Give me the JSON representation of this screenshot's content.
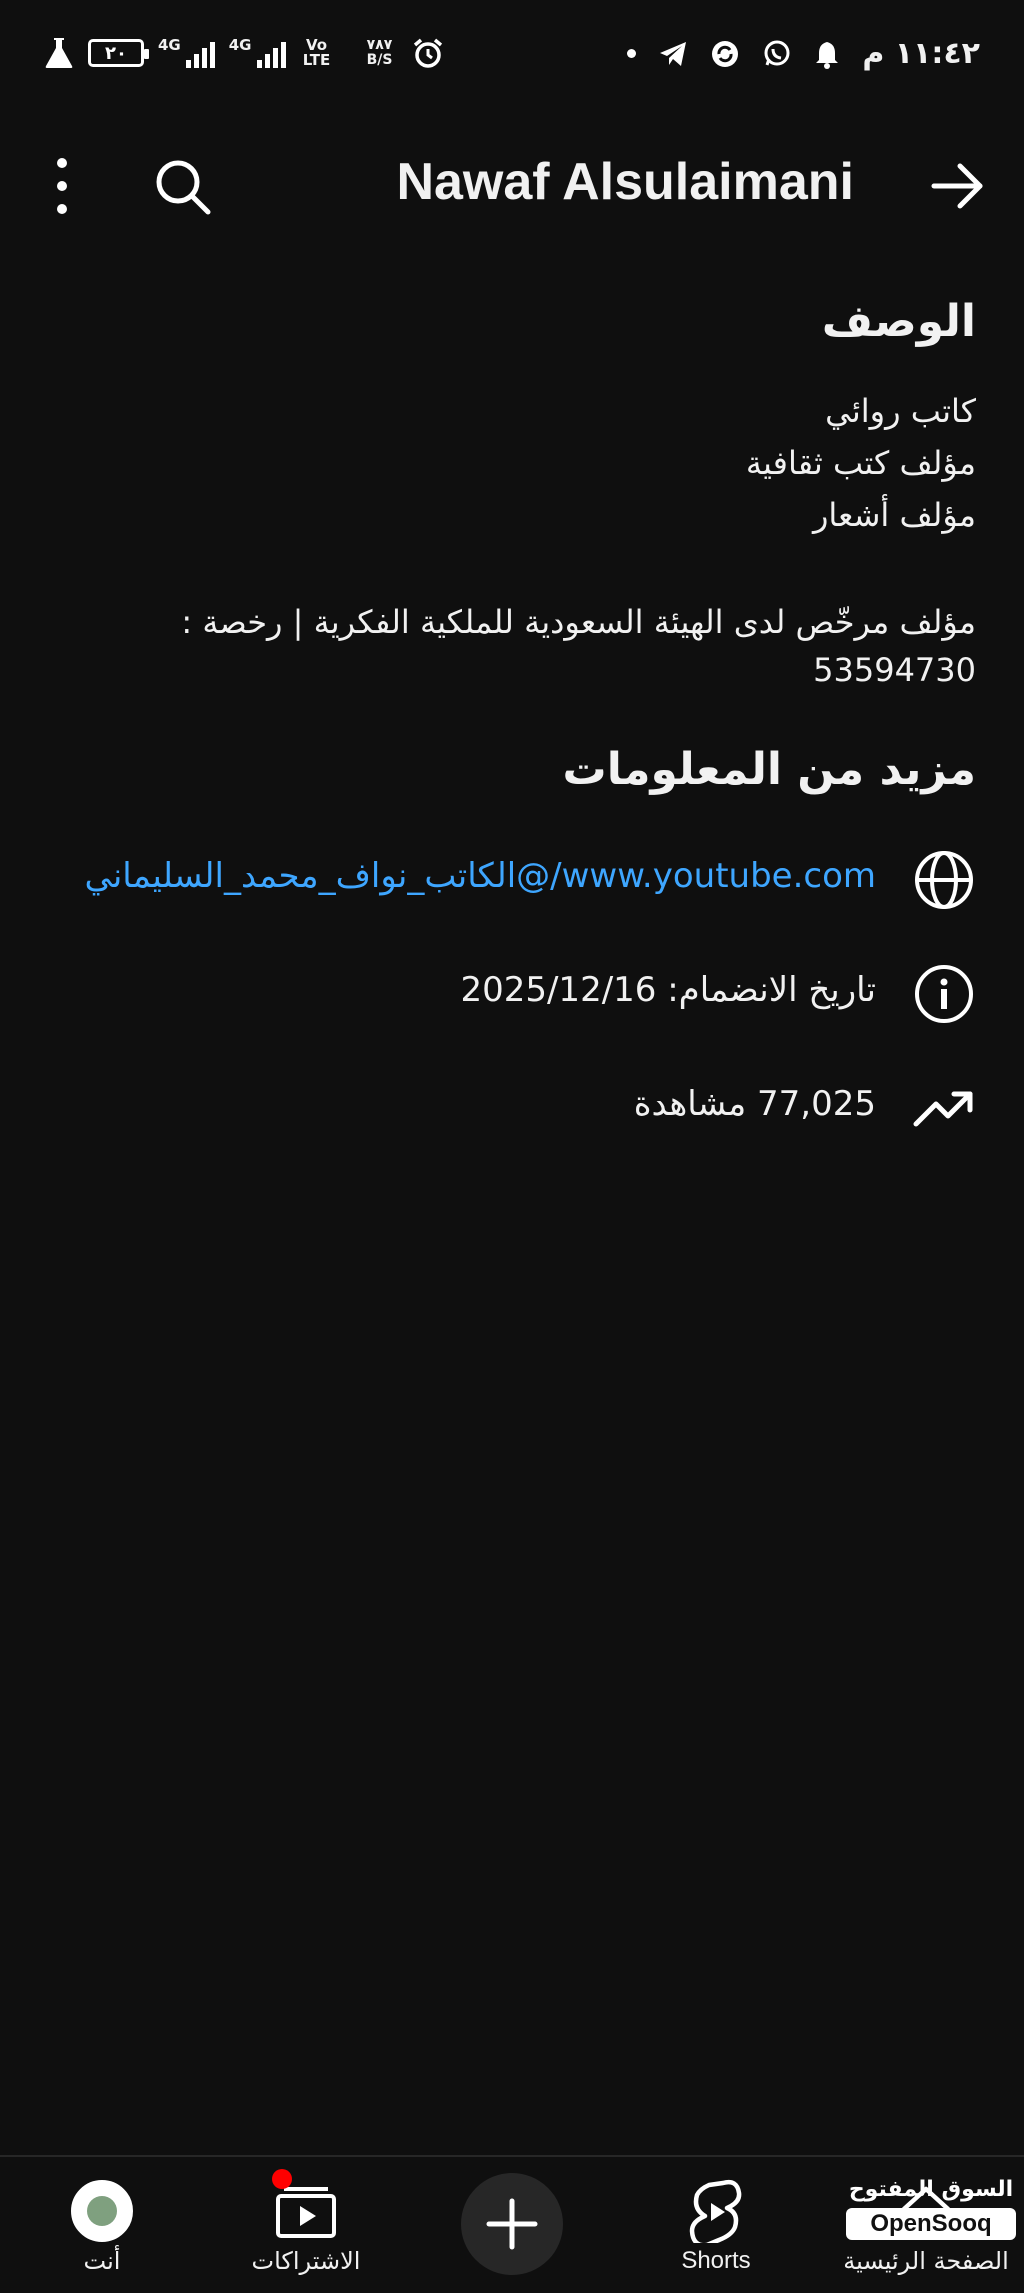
{
  "status_bar": {
    "time": "١١:٤٢ م",
    "battery": "٢٠",
    "signal1": "4G",
    "signal2": "4G",
    "volte": "Vo LTE",
    "speed": "٧٨٧ B/S"
  },
  "header": {
    "title": "Nawaf Alsulaimani",
    "icons": [
      "more-vert-icon",
      "search-icon",
      "arrow-forward-icon"
    ]
  },
  "description": {
    "heading": "الوصف",
    "lines": [
      "كاتب روائي",
      "مؤلف كتب ثقافية",
      "مؤلف أشعار"
    ],
    "license": "مؤلف مرخّص لدى الهيئة السعودية للملكية الفكرية | رخصة : 53594730"
  },
  "more_info": {
    "heading": "مزيد من المعلومات",
    "link": "www.youtube.com/@الكاتب_نواف_محمد_السليماني",
    "joined": "تاريخ الانضمام: 2025/12/16",
    "views": "77,025 مشاهدة"
  },
  "bottom_nav": {
    "home_label": "الصفحة الرئيسية",
    "shorts_label": "Shorts",
    "subscriptions_label": "الاشتراكات",
    "you_label": "أنت"
  },
  "watermark": {
    "arabic": "السوق المفتوح",
    "english": "OpenSooq"
  },
  "colors": {
    "background": "#0f0f0f",
    "link": "#3ea6ff",
    "notification_dot": "#ff0000"
  }
}
